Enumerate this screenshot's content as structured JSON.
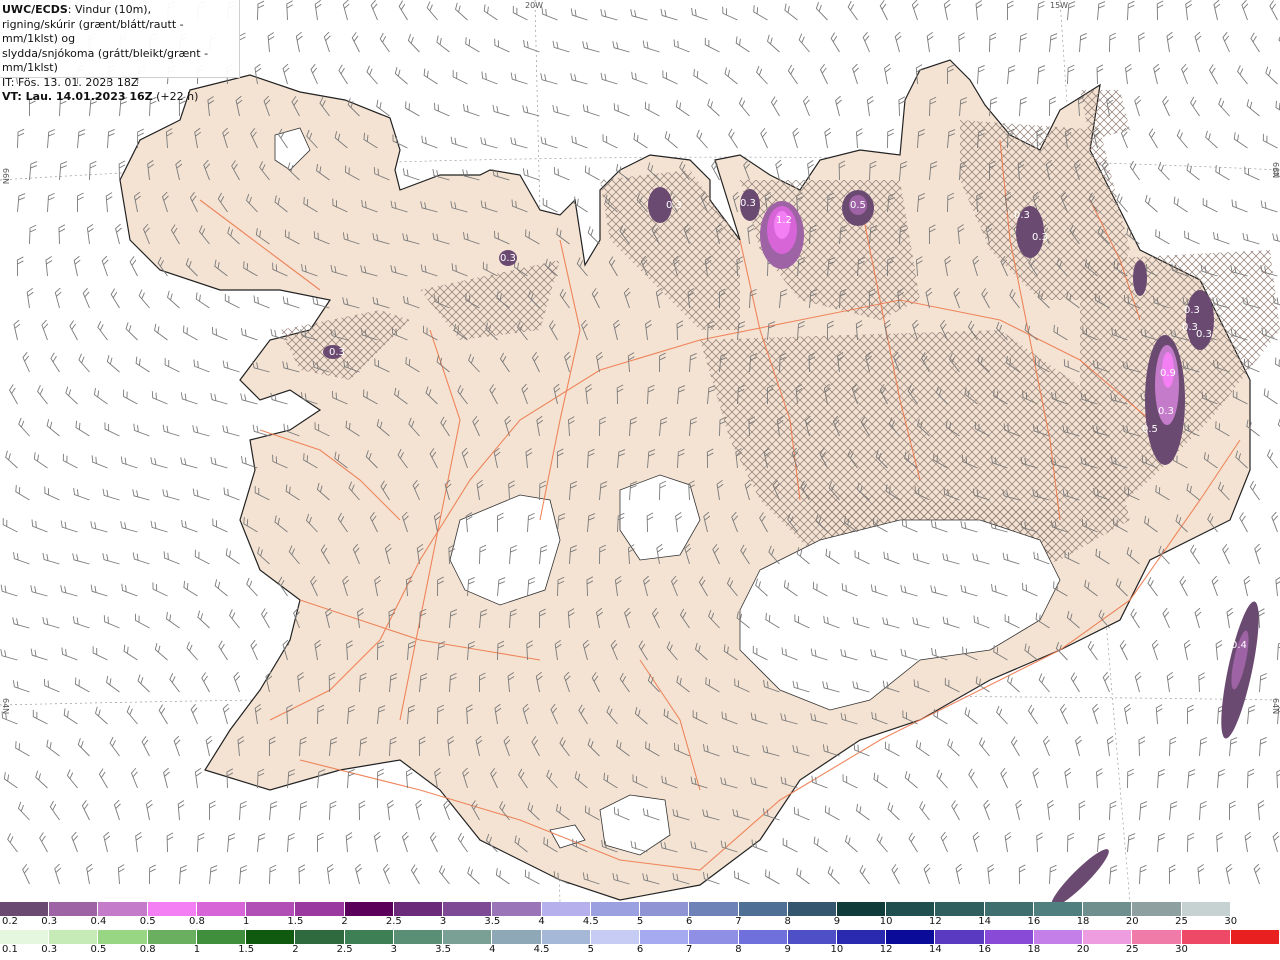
{
  "legend": {
    "model": "UWC/ECDS",
    "line1_rest": ": Vindur (10m),",
    "line2": "rigning/skúrir (grænt/blátt/rautt - mm/1klst) og",
    "line3": "slydda/snjókoma (grátt/bleikt/grænt - mm/1klst)",
    "line4": "IT: Fös. 13. 01. 2023 18Z",
    "line5_bold": "VT: Lau. 14.01.2023 16Z",
    "line5_rest": " (+22 h)"
  },
  "grid_labels": {
    "lon_20w": "20W",
    "lon_15w": "15W",
    "lat_66n_left": "66N",
    "lat_66n_right": "66N",
    "lat_64n_left": "64N",
    "lat_64n_right": "64N"
  },
  "precip_labels": [
    {
      "text": "0.3"
    },
    {
      "text": "0.3"
    },
    {
      "text": "1.2"
    },
    {
      "text": "0.5"
    },
    {
      "text": "0.3"
    },
    {
      "text": "0.3"
    },
    {
      "text": "0.3"
    },
    {
      "text": "0.3"
    },
    {
      "text": "0.3"
    },
    {
      "text": "0.9"
    },
    {
      "text": "0.3"
    },
    {
      "text": "0.5"
    },
    {
      "text": "0.4"
    },
    {
      "text": "0.3"
    },
    {
      "text": "0.3"
    }
  ],
  "colors": {
    "land": "#f4e3d3",
    "roads": "#ee7a4e",
    "wind_barb": "#7a7a7a",
    "hatch": "#8c7a72",
    "glacier": "#ffffff"
  },
  "snow_scale": {
    "labels": [
      "0.2",
      "0.3",
      "0.4",
      "0.5",
      "0.8",
      "1",
      "1.5",
      "2",
      "2.5",
      "3",
      "3.5",
      "4",
      "4.5",
      "5",
      "6",
      "7",
      "8",
      "9",
      "10",
      "12",
      "14",
      "16",
      "18",
      "20",
      "25",
      "30"
    ],
    "colors": [
      "#6b4a72",
      "#9d63a4",
      "#c47bc9",
      "#f47ff4",
      "#d765d8",
      "#b24fb6",
      "#9a3aa0",
      "#5a005a",
      "#6b2a7a",
      "#7f4a95",
      "#9a76b8",
      "#b6b0ec",
      "#9aa0e0",
      "#8f95d4",
      "#6f82b8",
      "#4f6f95",
      "#35566f",
      "#0f3b3b",
      "#1f4f4f",
      "#2f5f5f",
      "#3f6f6f",
      "#4f7f7f",
      "#6f8f8f",
      "#8fa0a0",
      "#c6d2d2",
      "#ffffff"
    ]
  },
  "rain_scale": {
    "labels": [
      "0.1",
      "0.3",
      "0.5",
      "0.8",
      "1",
      "1.5",
      "2",
      "2.5",
      "3",
      "3.5",
      "4",
      "4.5",
      "5",
      "6",
      "7",
      "8",
      "9",
      "10",
      "12",
      "14",
      "16",
      "18",
      "20",
      "25",
      "30"
    ],
    "colors": [
      "#e6f7df",
      "#c6ebb6",
      "#98d684",
      "#6aae5f",
      "#3f8f3c",
      "#0f5a0f",
      "#2f6a3f",
      "#3f7f55",
      "#5a8f75",
      "#7aa095",
      "#8fa8b8",
      "#a6b8d8",
      "#c6ccf4",
      "#a6aaf0",
      "#8f8fe6",
      "#7070dc",
      "#4f4fc8",
      "#2a2ab0",
      "#0b0b9a",
      "#5a3ac0",
      "#8a4ad8",
      "#c47fe8",
      "#ee9ee0",
      "#f07aa8",
      "#ee4a68",
      "#e82020"
    ]
  }
}
